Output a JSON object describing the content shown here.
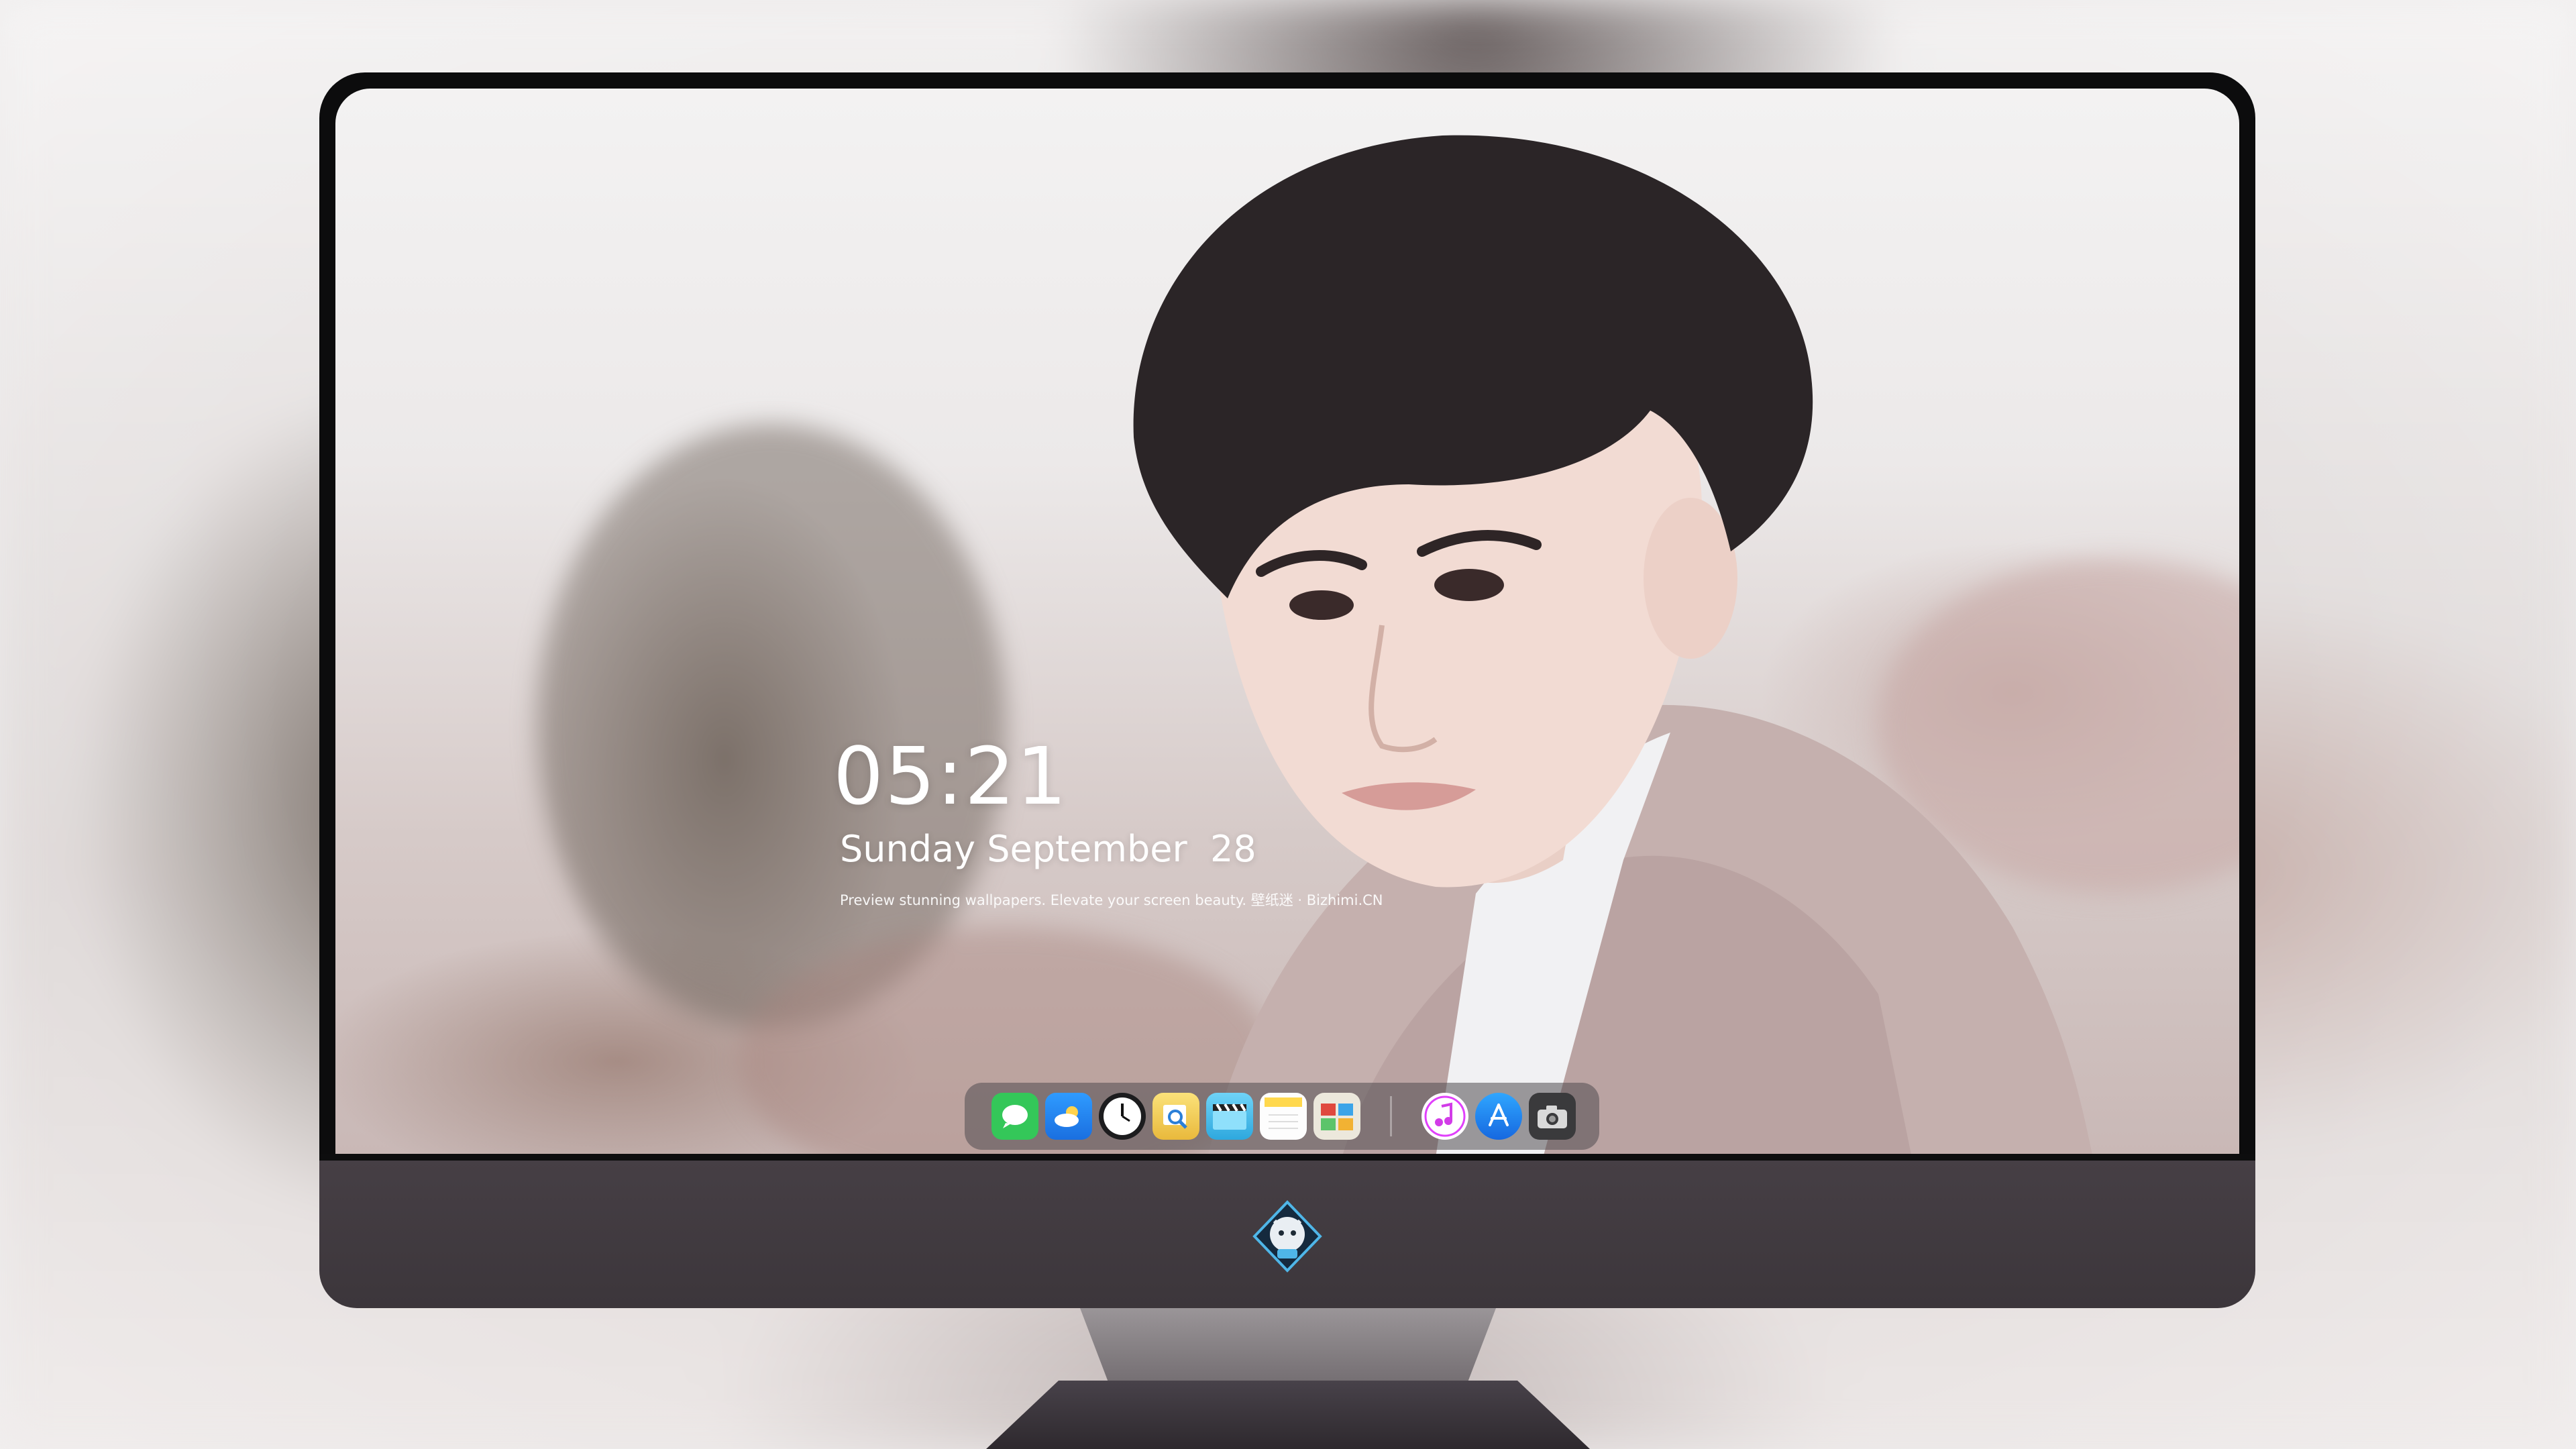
{
  "lock_screen": {
    "time": "05:21",
    "date": "Sunday September  28",
    "tagline": "Preview stunning wallpapers. Elevate your screen beauty. 壁纸迷 · Bizhimi.CN"
  },
  "dock": {
    "apps": [
      {
        "name": "messages-icon",
        "glyph": "💬",
        "color": "#34c759"
      },
      {
        "name": "weather-icon",
        "glyph": "☁",
        "color": "#2f8cf0"
      },
      {
        "name": "clock-icon",
        "glyph": "🕘",
        "color": "#ffffff"
      },
      {
        "name": "preview-icon",
        "glyph": "🔍",
        "color": "#f2c94c"
      },
      {
        "name": "video-icon",
        "glyph": "🎬",
        "color": "#5ac8fa"
      },
      {
        "name": "notes-icon",
        "glyph": "📝",
        "color": "#ffd84d"
      },
      {
        "name": "photo-booth-icon",
        "glyph": "🖼",
        "color": "#e8e4d8"
      }
    ],
    "apps_right": [
      {
        "name": "music-icon",
        "glyph": "♫",
        "color": "#e040fb"
      },
      {
        "name": "app-store-icon",
        "glyph": "Ⓐ",
        "color": "#1e90ff"
      },
      {
        "name": "camera-icon",
        "glyph": "📷",
        "color": "#3a3a3c"
      }
    ]
  },
  "colors": {
    "bezel": "#0c0c0d",
    "chin": "#463f45",
    "stand": "#9a9598"
  }
}
